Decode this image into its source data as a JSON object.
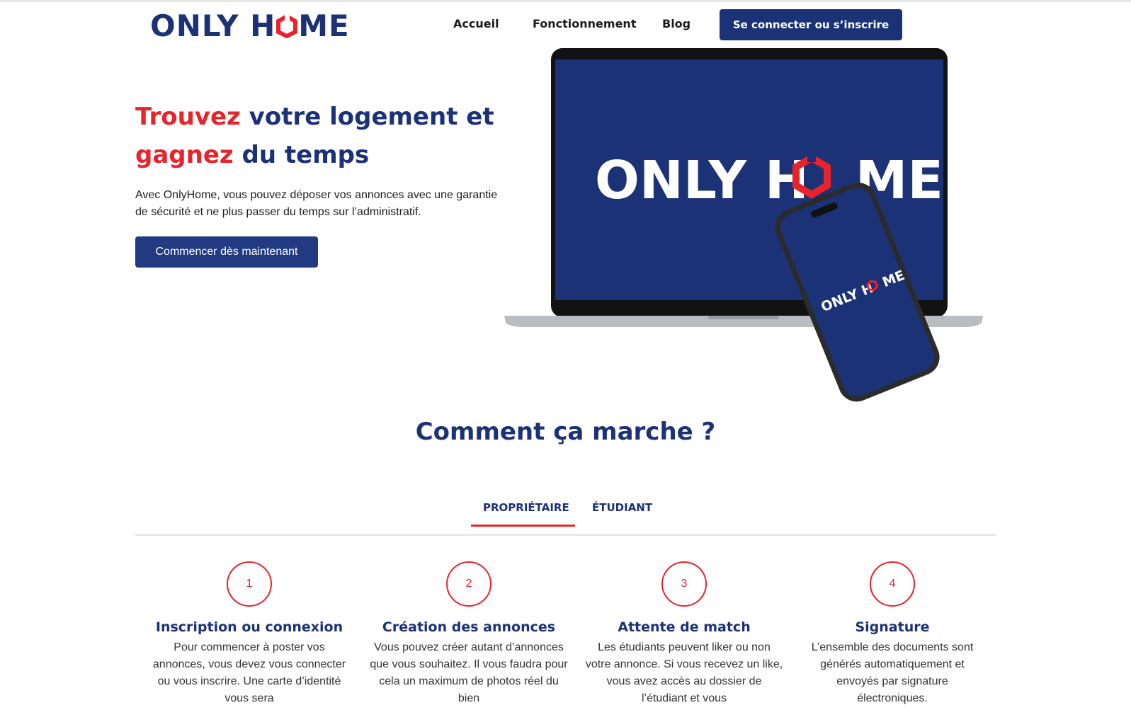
{
  "brand": {
    "name_part1": "ONLY H",
    "name_part2": "ME",
    "colors": {
      "primary": "#1c3277",
      "accent": "#e8232b"
    }
  },
  "nav": {
    "items": [
      "Accueil",
      "Fonctionnement",
      "Blog"
    ],
    "cta": "Se connecter ou s’inscrire"
  },
  "hero": {
    "title_red_1": "Trouvez",
    "title_blue_1": " votre logement et",
    "title_red_2": "gagnez",
    "title_blue_2": " du temps",
    "text": "Avec OnlyHome, vous pouvez déposer vos annonces avec une garantie de sécurité et ne plus passer du temps sur l’administratif.",
    "cta": "Commencer dès maintenant",
    "laptop_logo_part1": "ONLY H",
    "laptop_logo_part2": "ME",
    "phone_logo_part1": "ONLY H",
    "phone_logo_part2": "ME"
  },
  "how": {
    "title": "Comment ça marche ?",
    "tabs": [
      "PROPRIÉTAIRE",
      "ÉTUDIANT"
    ],
    "active_tab": "PROPRIÉTAIRE",
    "steps": [
      {
        "number": "1",
        "title": "Inscription ou connexion",
        "text": "Pour commencer à poster vos annonces, vous devez vous connecter ou vous inscrire. Une carte d’identité vous sera"
      },
      {
        "number": "2",
        "title": "Création des annonces",
        "text": "Vous pouvez créer autant d’annonces que vous souhaitez. Il vous faudra pour cela un maximum de photos réel du bien"
      },
      {
        "number": "3",
        "title": "Attente de match",
        "text": "Les étudiants peuvent liker ou non votre annonce. Si vous recevez un like, vous avez accès au dossier de l’étudiant et vous"
      },
      {
        "number": "4",
        "title": "Signature",
        "text": "L’ensemble des documents sont générés automatiquement et envoyés par signature électroniques."
      }
    ]
  }
}
